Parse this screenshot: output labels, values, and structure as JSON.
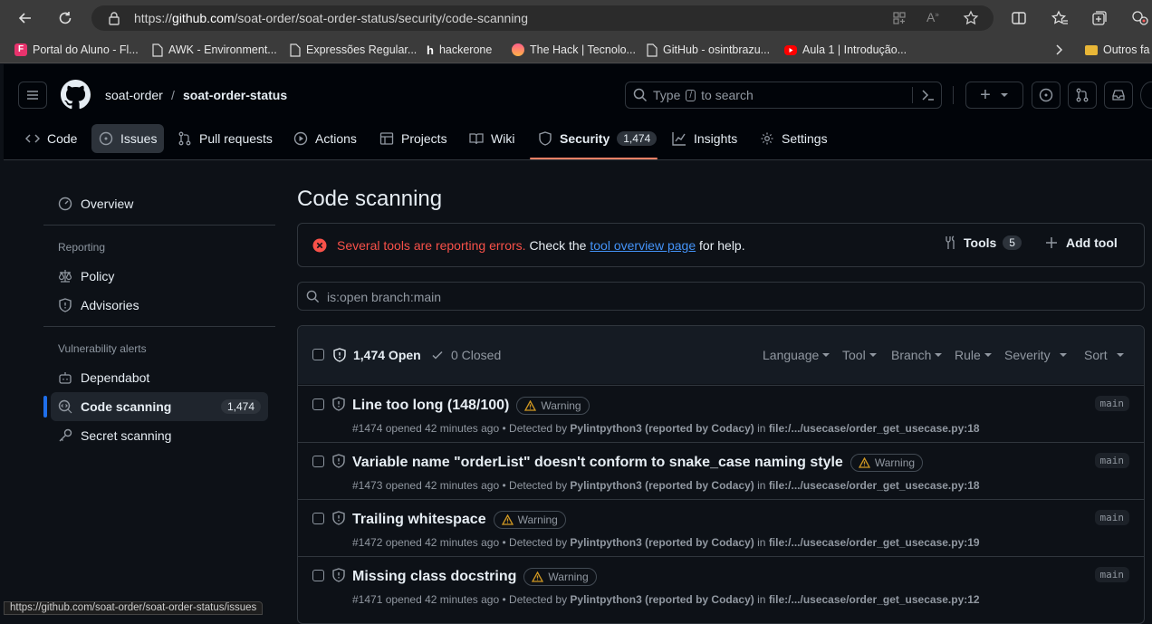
{
  "browser": {
    "url_prefix": "https://",
    "url_host": "github.com",
    "url_path": "/soat-order/soat-order-status/security/code-scanning",
    "bookmarks": [
      {
        "label": "Portal do Aluno - Fl..."
      },
      {
        "label": "AWK - Environment..."
      },
      {
        "label": "Expressões Regular..."
      },
      {
        "label": "hackerone"
      },
      {
        "label": "The Hack | Tecnolo..."
      },
      {
        "label": "GitHub - osintbrazu..."
      },
      {
        "label": "Aula 1 | Introdução..."
      }
    ],
    "other_favorites": "Outros fa",
    "status_url": "https://github.com/soat-order/soat-order-status/issues"
  },
  "header": {
    "owner": "soat-order",
    "separator": "/",
    "repo": "soat-order-status",
    "search_prefix": "Type",
    "search_key": "/",
    "search_suffix": "to search",
    "plus": "+"
  },
  "tabs": [
    {
      "label": "Code"
    },
    {
      "label": "Issues"
    },
    {
      "label": "Pull requests"
    },
    {
      "label": "Actions"
    },
    {
      "label": "Projects"
    },
    {
      "label": "Wiki"
    },
    {
      "label": "Security",
      "count": "1,474"
    },
    {
      "label": "Insights"
    },
    {
      "label": "Settings"
    }
  ],
  "sidebar": {
    "overview": "Overview",
    "reporting_heading": "Reporting",
    "policy": "Policy",
    "advisories": "Advisories",
    "vuln_heading": "Vulnerability alerts",
    "dependabot": "Dependabot",
    "code_scanning": "Code scanning",
    "code_scanning_count": "1,474",
    "secret_scanning": "Secret scanning"
  },
  "main": {
    "title": "Code scanning",
    "error_text": "Several tools are reporting errors.",
    "check_text": "Check the",
    "link_text": "tool overview page",
    "help_text": "for help.",
    "tools_label": "Tools",
    "tools_count": "5",
    "add_tool": "Add tool",
    "search_value": "is:open branch:main",
    "open_label": "1,474 Open",
    "closed_label": "0 Closed",
    "filters": [
      "Language",
      "Tool",
      "Branch",
      "Rule",
      "Severity",
      "Sort"
    ]
  },
  "alerts": [
    {
      "title": "Line too long (148/100)",
      "severity": "Warning",
      "number": "#1474",
      "opened": "opened 42 minutes ago",
      "detected": "• Detected by",
      "tool": "Pylintpython3 (reported by Codacy)",
      "in": "in",
      "file": "file:/.../usecase/order_get_usecase.py:18",
      "branch": "main"
    },
    {
      "title": "Variable name \"orderList\" doesn't conform to snake_case naming style",
      "severity": "Warning",
      "number": "#1473",
      "opened": "opened 42 minutes ago",
      "detected": "• Detected by",
      "tool": "Pylintpython3 (reported by Codacy)",
      "in": "in",
      "file": "file:/.../usecase/order_get_usecase.py:18",
      "branch": "main"
    },
    {
      "title": "Trailing whitespace",
      "severity": "Warning",
      "number": "#1472",
      "opened": "opened 42 minutes ago",
      "detected": "• Detected by",
      "tool": "Pylintpython3 (reported by Codacy)",
      "in": "in",
      "file": "file:/.../usecase/order_get_usecase.py:19",
      "branch": "main"
    },
    {
      "title": "Missing class docstring",
      "severity": "Warning",
      "number": "#1471",
      "opened": "opened 42 minutes ago",
      "detected": "• Detected by",
      "tool": "Pylintpython3 (reported by Codacy)",
      "in": "in",
      "file": "file:/.../usecase/order_get_usecase.py:12",
      "branch": "main"
    }
  ],
  "colors": {
    "accent": "#1f6feb",
    "danger": "#f85149",
    "link": "#4493f8",
    "warning": "#d29922",
    "tab_underline": "#f78166"
  }
}
